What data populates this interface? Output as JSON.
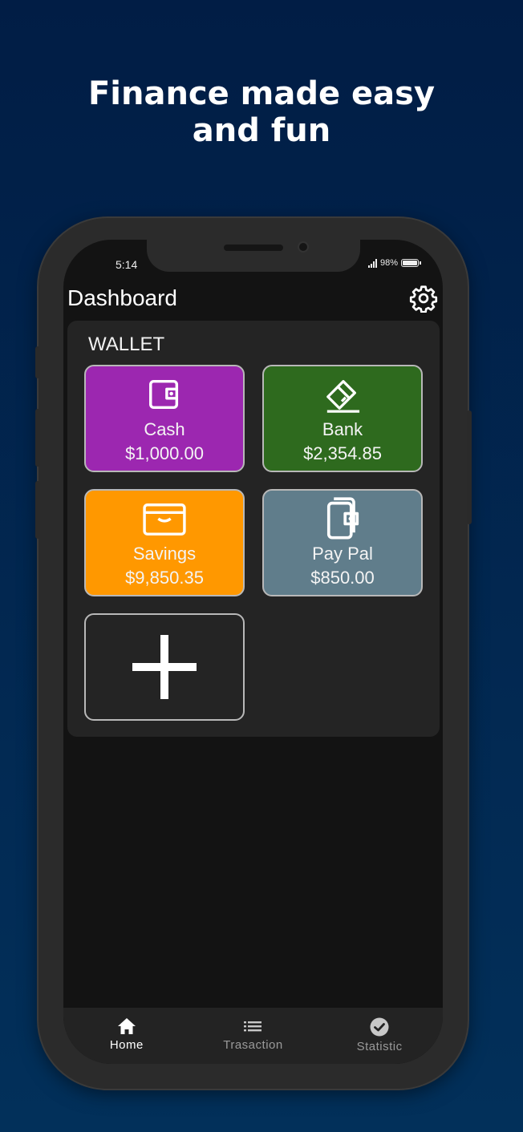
{
  "headline": {
    "line1": "Finance made easy",
    "line2": "and fun"
  },
  "status_bar": {
    "time": "5:14",
    "battery": "98%"
  },
  "header": {
    "title": "Dashboard",
    "settings_icon": "gear-icon"
  },
  "wallet": {
    "label": "WALLET",
    "cards": [
      {
        "name": "Cash",
        "amount": "$1,000.00",
        "color": "#9c27b0",
        "icon": "wallet-icon"
      },
      {
        "name": "Bank",
        "amount": "$2,354.85",
        "color": "#2e6a1e",
        "icon": "credit-card-icon"
      },
      {
        "name": "Savings",
        "amount": "$9,850.35",
        "color": "#ff9800",
        "icon": "pouch-icon"
      },
      {
        "name": "Pay Pal",
        "amount": "$850.00",
        "color": "#607d8b",
        "icon": "mobile-wallet-icon"
      }
    ],
    "add_icon": "plus-icon"
  },
  "nav": {
    "items": [
      {
        "label": "Home",
        "icon": "home-icon",
        "active": true
      },
      {
        "label": "Trasaction",
        "icon": "list-icon",
        "active": false
      },
      {
        "label": "Statistic",
        "icon": "check-circle-icon",
        "active": false
      }
    ]
  }
}
